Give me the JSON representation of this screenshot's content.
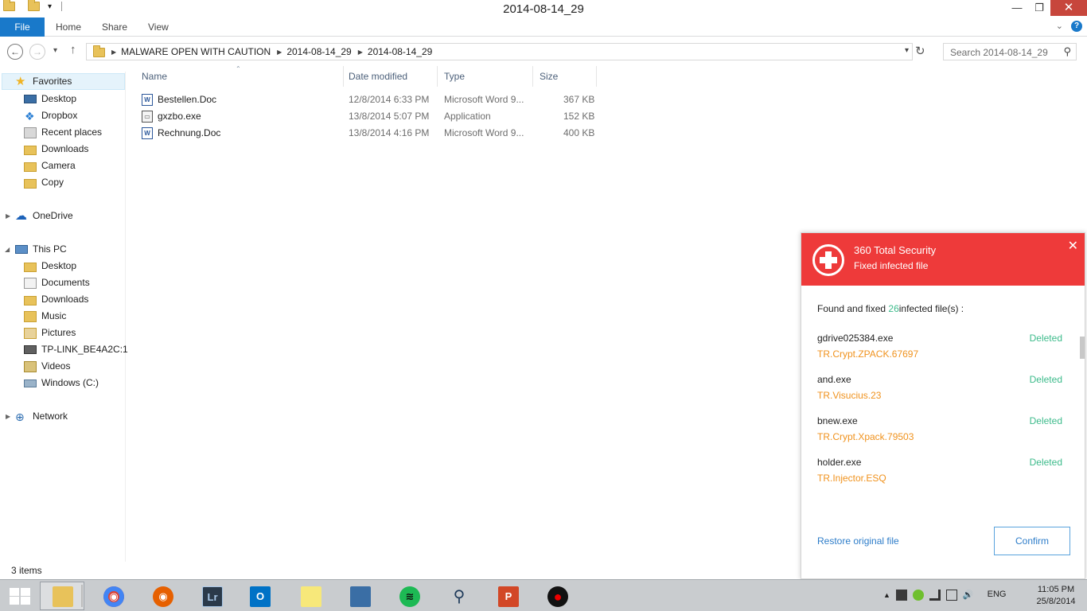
{
  "window": {
    "title": "2014-08-14_29",
    "minimize_glyph": "—",
    "restore_glyph": "❐",
    "close_glyph": "✕",
    "qat_glyph": "▾"
  },
  "ribbon": {
    "tabs": [
      "File",
      "Home",
      "Share",
      "View"
    ],
    "expand_glyph": "⌄",
    "help_glyph": "?"
  },
  "navigation": {
    "back_glyph": "←",
    "forward_glyph": "→",
    "recent_glyph": "▾",
    "up_glyph": "↑",
    "breadcrumb": [
      "MALWARE OPEN WITH CAUTION",
      "2014-08-14_29",
      "2014-08-14_29"
    ],
    "separator_glyph": "▶",
    "dropdown_glyph": "▾",
    "refresh_glyph": "↻",
    "search_placeholder": "Search 2014-08-14_29",
    "search_glyph": "⚲"
  },
  "nav_pane": {
    "favorites_label": "Favorites",
    "favorites": [
      "Desktop",
      "Dropbox",
      "Recent places",
      "Downloads",
      "Camera",
      "Copy"
    ],
    "onedrive_label": "OneDrive",
    "thispc_label": "This PC",
    "thispc": [
      "Desktop",
      "Documents",
      "Downloads",
      "Music",
      "Pictures",
      "TP-LINK_BE4A2C:1",
      "Videos",
      "Windows (C:)"
    ],
    "network_label": "Network",
    "expand_glyph": "▶",
    "collapse_glyph": "◢"
  },
  "file_list": {
    "columns": [
      "Name",
      "Date modified",
      "Type",
      "Size"
    ],
    "sort_glyph": "⌃",
    "rows": [
      {
        "name": "Bestellen.Doc",
        "date": "12/8/2014 6:33 PM",
        "type": "Microsoft Word 9...",
        "size": "367 KB",
        "icon": "word-doc-icon",
        "icon_glyph": "W"
      },
      {
        "name": "gxzbo.exe",
        "date": "13/8/2014 5:07 PM",
        "type": "Application",
        "size": "152 KB",
        "icon": "application-icon",
        "icon_glyph": "▭"
      },
      {
        "name": "Rechnung.Doc",
        "date": "13/8/2014 4:16 PM",
        "type": "Microsoft Word 9...",
        "size": "400 KB",
        "icon": "word-doc-icon",
        "icon_glyph": "W"
      }
    ]
  },
  "status_bar": {
    "item_count": "3 items"
  },
  "security_popup": {
    "title": "360 Total Security",
    "subtitle": "Fixed infected file",
    "close_glyph": "✕",
    "found_prefix": "Found and fixed ",
    "found_count": "26",
    "found_suffix": "infected file(s) :",
    "threats": [
      {
        "file": "gdrive025384.exe",
        "threat": "TR.Crypt.ZPACK.67697",
        "status": "Deleted"
      },
      {
        "file": "and.exe",
        "threat": "TR.Visucius.23",
        "status": "Deleted"
      },
      {
        "file": "bnew.exe",
        "threat": "TR.Crypt.Xpack.79503",
        "status": "Deleted"
      },
      {
        "file": "holder.exe",
        "threat": "TR.Injector.ESQ",
        "status": "Deleted"
      }
    ],
    "restore_label": "Restore original file",
    "confirm_label": "Confirm",
    "colors": {
      "header": "#ee3a3a",
      "threat": "#f0921d",
      "status": "#3dbb8b",
      "link": "#2c7cc9"
    }
  },
  "taskbar": {
    "apps": [
      {
        "name": "file-explorer",
        "glyph": "",
        "active": true
      },
      {
        "name": "chrome",
        "glyph": "◉"
      },
      {
        "name": "firefox",
        "glyph": "◉"
      },
      {
        "name": "lightroom",
        "glyph": "Lr"
      },
      {
        "name": "outlook",
        "glyph": "O"
      },
      {
        "name": "sticky-notes",
        "glyph": ""
      },
      {
        "name": "app-window",
        "glyph": ""
      },
      {
        "name": "spotify",
        "glyph": "≋"
      },
      {
        "name": "magnifier",
        "glyph": "⚲"
      },
      {
        "name": "powerpoint",
        "glyph": "P"
      },
      {
        "name": "recorder",
        "glyph": "●"
      }
    ],
    "tray_up_glyph": "▲",
    "volume_glyph": "🔊",
    "language": "ENG",
    "time": "11:05 PM",
    "date": "25/8/2014"
  }
}
